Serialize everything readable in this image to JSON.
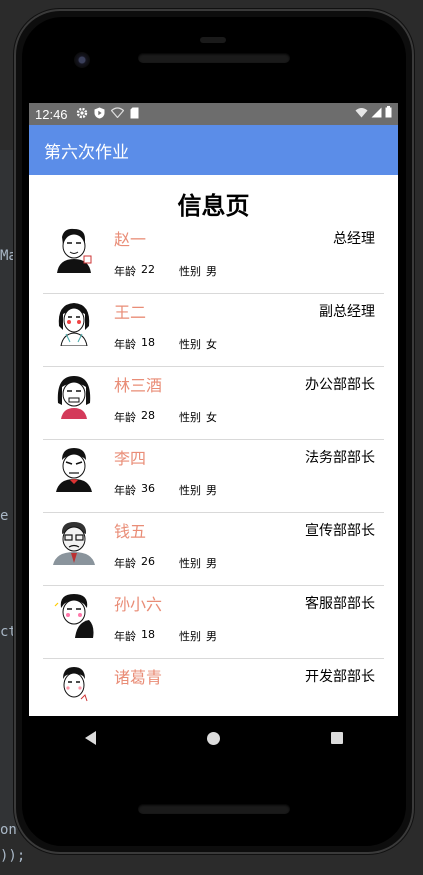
{
  "ide": {
    "frag1": "Ma",
    "frag2": "e",
    "frag3": "ct",
    "frag4": "on",
    "frag5": "));"
  },
  "status_bar": {
    "time": "12:46",
    "icons": [
      "gear-icon",
      "shield-play-icon",
      "wifi-off-icon",
      "sd-card-icon"
    ],
    "right_icons": [
      "wifi-icon",
      "signal-icon",
      "battery-icon"
    ]
  },
  "app_bar": {
    "title": "第六次作业"
  },
  "page": {
    "heading": "信息页"
  },
  "labels": {
    "age": "年龄",
    "sex": "性别"
  },
  "people": [
    {
      "name": "赵一",
      "title": "总经理",
      "age": "22",
      "sex": "男"
    },
    {
      "name": "王二",
      "title": "副总经理",
      "age": "18",
      "sex": "女"
    },
    {
      "name": "林三酒",
      "title": "办公部部长",
      "age": "28",
      "sex": "女"
    },
    {
      "name": "李四",
      "title": "法务部部长",
      "age": "36",
      "sex": "男"
    },
    {
      "name": "钱五",
      "title": "宣传部部长",
      "age": "26",
      "sex": "男"
    },
    {
      "name": "孙小六",
      "title": "客服部部长",
      "age": "18",
      "sex": "男"
    },
    {
      "name": "诸葛青",
      "title": "开发部部长",
      "age": "",
      "sex": ""
    }
  ],
  "colors": {
    "app_bar": "#5b8de8",
    "status_bar": "#6d6d6d",
    "name_text": "#e98d77"
  }
}
